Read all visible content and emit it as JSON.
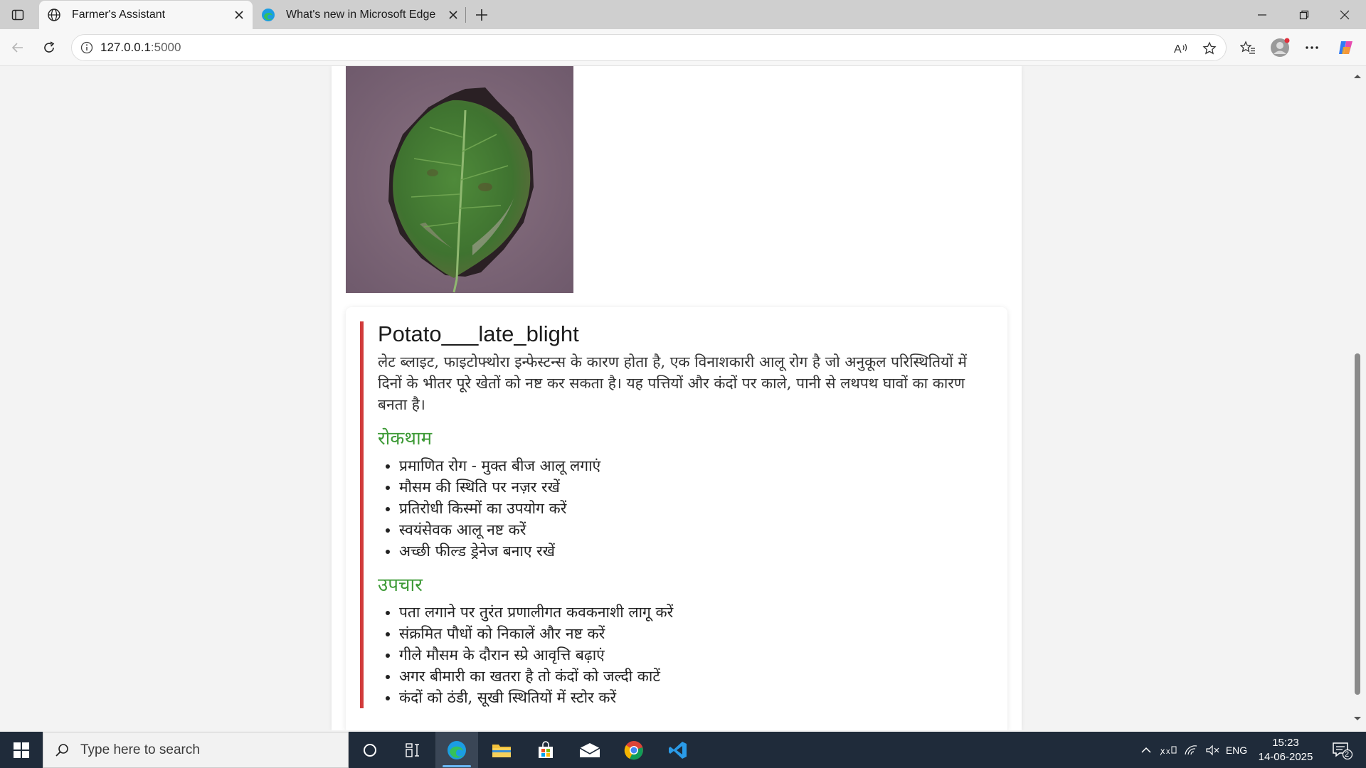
{
  "browser": {
    "tabs": [
      {
        "title": "Farmer's Assistant",
        "active": true,
        "icon": "globe-icon"
      },
      {
        "title": "What's new in Microsoft Edge",
        "active": false,
        "icon": "edge-icon"
      }
    ],
    "address": {
      "host": "127.0.0.1",
      "port": ":5000"
    }
  },
  "page": {
    "image_alt": "potato-leaf-photo",
    "result": {
      "disease_name": "Potato___late_blight",
      "description": "लेट ब्लाइट, फाइटोफ्थोरा इन्फेस्टन्स के कारण होता है, एक विनाशकारी आलू रोग है जो अनुकूल परिस्थितियों में दिनों के भीतर पूरे खेतों को नष्ट कर सकता है। यह पत्तियों और कंदों पर काले, पानी से लथपथ घावों का कारण बनता है।",
      "prevention_title": "रोकथाम",
      "prevention": [
        "प्रमाणित रोग - मुक्त बीज आलू लगाएं",
        "मौसम की स्थिति पर नज़र रखें",
        "प्रतिरोधी किस्मों का उपयोग करें",
        "स्वयंसेवक आलू नष्ट करें",
        "अच्छी फील्ड ड्रेनेज बनाए रखें"
      ],
      "treatment_title": "उपचार",
      "treatment": [
        "पता लगाने पर तुरंत प्रणालीगत कवकनाशी लागू करें",
        "संक्रमित पौधों को निकालें और नष्ट करें",
        "गीले मौसम के दौरान स्प्रे आवृत्ति बढ़ाएं",
        "अगर बीमारी का खतरा है तो कंदों को जल्दी काटें",
        "कंदों को ठंडी, सूखी स्थितियों में स्टोर करें"
      ]
    }
  },
  "taskbar": {
    "search_placeholder": "Type here to search",
    "language": "ENG",
    "time": "15:23",
    "date": "14-06-2025",
    "notifications": "2"
  },
  "colors": {
    "accent_red": "#d13b3b",
    "section_green": "#3d9a36",
    "taskbar": "#1f2b3a"
  }
}
